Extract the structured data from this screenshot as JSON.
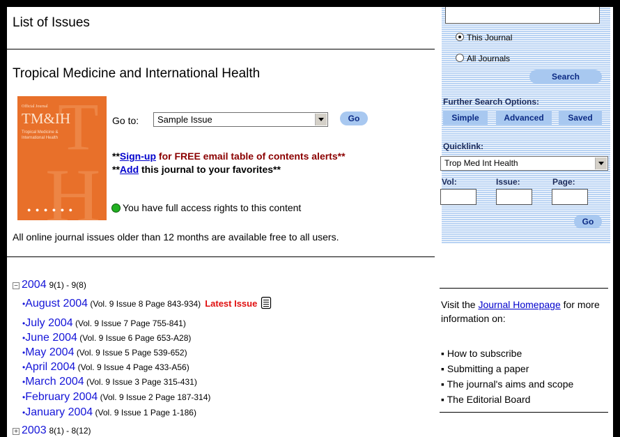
{
  "page": {
    "title": "List of Issues",
    "journal_title": "Tropical Medicine and International Health"
  },
  "cover": {
    "small_text": "Official Journal",
    "acronym": "TM&IH",
    "subtitle_line1": "Tropical Medicine &",
    "subtitle_line2": "International Health"
  },
  "goto": {
    "label": "Go to:",
    "selected": "Sample Issue",
    "button": "Go"
  },
  "alerts": {
    "line1_prefix": "**",
    "line1_link": "Sign-up",
    "line1_rest": " for FREE email table of contents alerts**",
    "line2_prefix": "**",
    "line2_link": "Add",
    "line2_rest": " this journal to your favorites**"
  },
  "access_text": "You have full access rights to this content",
  "free_note": "All online journal issues older than 12 months are available free to all users.",
  "years": [
    {
      "toggle": "−",
      "year": "2004",
      "range": "9(1) - 9(8)"
    },
    {
      "toggle": "+",
      "year": "2003",
      "range": "8(1) - 8(12)"
    }
  ],
  "issues": [
    {
      "label": "August 2004",
      "detail": "(Vol. 9 Issue 8 Page 843-934)",
      "latest": "Latest Issue"
    },
    {
      "label": "July 2004",
      "detail": "(Vol. 9 Issue 7 Page 755-841)"
    },
    {
      "label": "June 2004",
      "detail": "(Vol. 9 Issue 6 Page 653-A28)"
    },
    {
      "label": "May 2004",
      "detail": "(Vol. 9 Issue 5 Page 539-652)"
    },
    {
      "label": "April 2004",
      "detail": "(Vol. 9 Issue 4 Page 433-A56)"
    },
    {
      "label": "March 2004",
      "detail": "(Vol. 9 Issue 3 Page 315-431)"
    },
    {
      "label": "February 2004",
      "detail": "(Vol. 9 Issue 2 Page 187-314)"
    },
    {
      "label": "January 2004",
      "detail": "(Vol. 9 Issue 1 Page 1-186)"
    }
  ],
  "sidebar": {
    "radio_this": "This Journal",
    "radio_all": "All Journals",
    "search_button": "Search",
    "further_label": "Further Search Options:",
    "options": [
      "Simple",
      "Advanced",
      "Saved"
    ],
    "quicklink_label": "Quicklink:",
    "quicklink_value": "Trop Med Int Health",
    "vol_label": "Vol:",
    "issue_label": "Issue:",
    "page_label": "Page:",
    "go_button": "Go"
  },
  "side_info": {
    "visit_prefix": "Visit the ",
    "homepage_link": "Journal Homepage",
    "visit_suffix": " for more information on:",
    "items": [
      "How to subscribe",
      "Submitting a paper",
      "The journal's aims and scope",
      "The Editorial Board"
    ]
  },
  "colors": {
    "link": "#1515d8",
    "latest": "#e01010",
    "button_bg": "#a8c8f0",
    "cover": "#e8702a"
  }
}
